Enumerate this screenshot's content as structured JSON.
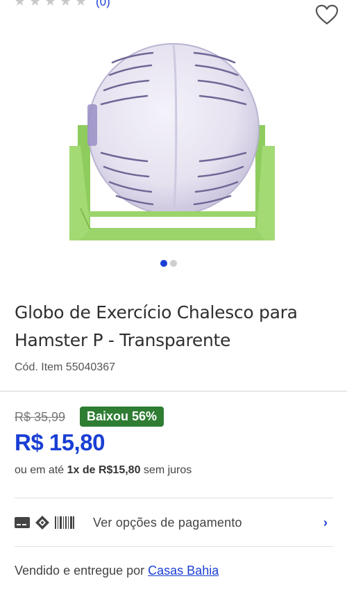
{
  "rating": {
    "stars": 5,
    "filled": 0,
    "review_count": "(0)"
  },
  "favorite_icon": "heart-outline-icon",
  "gallery": {
    "image_count": 2,
    "active_index": 0
  },
  "product": {
    "title": "Globo de Exercício Chalesco para Hamster P - Transparente",
    "sku": "Cód. Item 55040367"
  },
  "pricing": {
    "old_price": "R$ 35,99",
    "discount": "Baixou 56%",
    "price": "R$ 15,80",
    "installment_prefix": "ou em até ",
    "installment_bold": "1x de R$15,80",
    "installment_suffix": " sem juros"
  },
  "payment": {
    "label": "Ver opções de pagamento",
    "icons": [
      "card-icon",
      "pix-icon",
      "barcode-icon"
    ]
  },
  "seller": {
    "prefix": "Vendido e entregue por ",
    "name": "Casas Bahia"
  },
  "colors": {
    "accent": "#1a3fd4",
    "discount": "#2e7d32",
    "stand": "#9ad46a"
  }
}
